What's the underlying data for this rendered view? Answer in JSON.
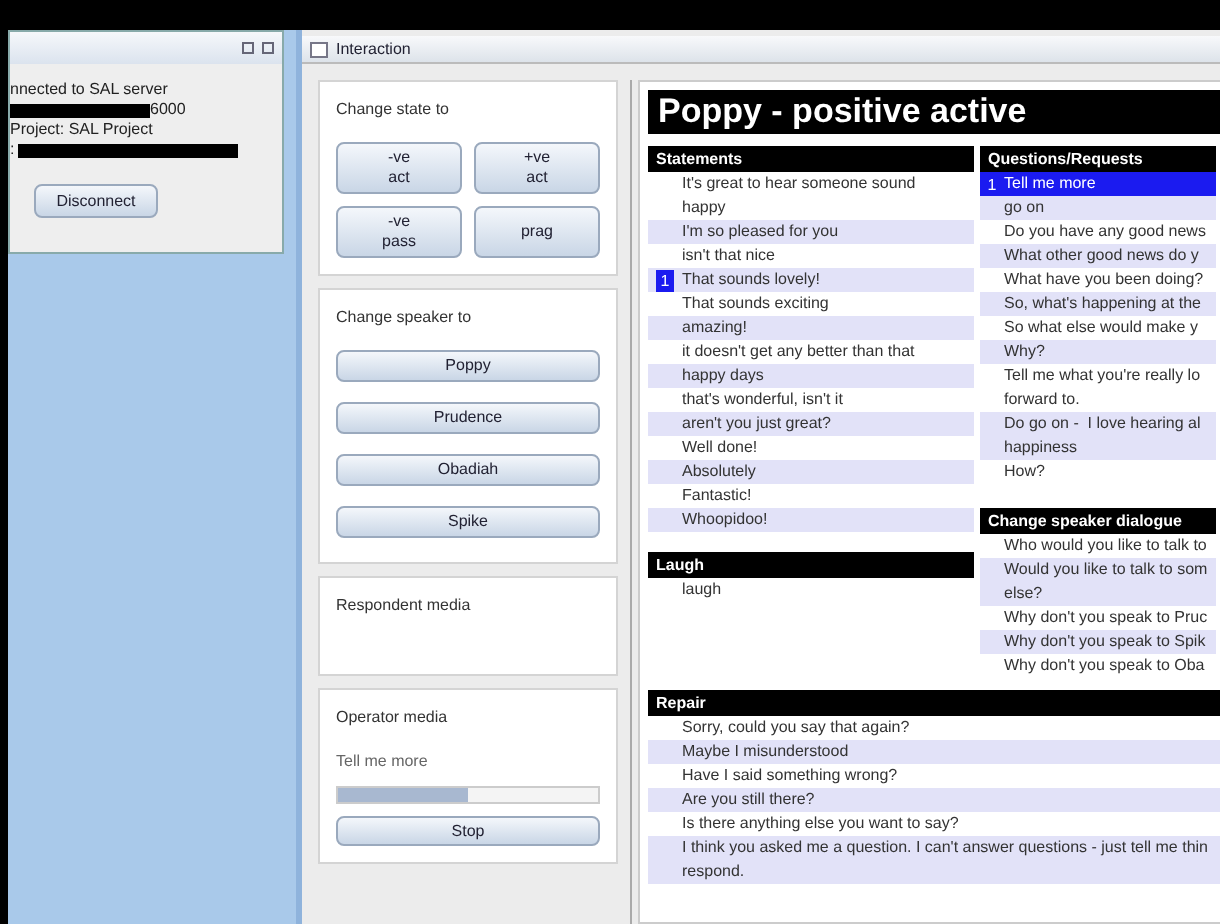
{
  "server_window": {
    "lines": [
      {
        "kind": "text",
        "text": "nnected to SAL server"
      },
      {
        "kind": "redacted_suffix",
        "text": "6000"
      },
      {
        "kind": "text",
        "text": "Project: SAL Project"
      },
      {
        "kind": "redacted_prefix",
        "text": ":"
      }
    ],
    "button": "Disconnect"
  },
  "window": {
    "title": "Interaction"
  },
  "state_panel": {
    "title": "Change state to",
    "buttons": [
      [
        "-ve",
        "act"
      ],
      [
        "+ve",
        "act"
      ],
      [
        "-ve",
        "pass"
      ],
      [
        "prag"
      ]
    ]
  },
  "speaker_panel": {
    "title": "Change speaker to",
    "buttons": [
      "Poppy",
      "Prudence",
      "Obadiah",
      "Spike"
    ]
  },
  "respondent_panel": {
    "title": "Respondent media"
  },
  "operator_panel": {
    "title": "Operator media",
    "caption": "Tell me more",
    "level": 0.5,
    "button": "Stop"
  },
  "heading": "Poppy - positive active",
  "statements": {
    "title": "Statements",
    "items": [
      {
        "text": "It's great to hear someone sound\nhappy"
      },
      {
        "text": "I'm so pleased for you"
      },
      {
        "text": "isn't that nice"
      },
      {
        "text": "That sounds lovely!",
        "marker": "1"
      },
      {
        "text": "That sounds exciting"
      },
      {
        "text": "amazing!"
      },
      {
        "text": "it doesn't get any better than that"
      },
      {
        "text": "happy days"
      },
      {
        "text": "that's wonderful, isn't it"
      },
      {
        "text": "aren't you just great?"
      },
      {
        "text": "Well done!"
      },
      {
        "text": "Absolutely"
      },
      {
        "text": "Fantastic!"
      },
      {
        "text": "Whoopidoo!"
      }
    ]
  },
  "questions": {
    "title": "Questions/Requests",
    "items": [
      {
        "text": "Tell me more",
        "selected": true,
        "marker": "1"
      },
      {
        "text": "go on",
        "selected": false
      },
      {
        "text": "Do you have any good news",
        "selected": false
      },
      {
        "text": "What other good news do y",
        "selected": false
      },
      {
        "text": "What have you been doing?",
        "selected": false
      },
      {
        "text": "So, what's happening at the",
        "selected": false
      },
      {
        "text": "So what else would make y",
        "selected": false
      },
      {
        "text": "Why?",
        "selected": false
      },
      {
        "text": "Tell me what you're really lo\nforward to.",
        "selected": false
      },
      {
        "text": "Do go on -  I love hearing al\nhappiness",
        "selected": false
      },
      {
        "text": "How?",
        "selected": false
      }
    ]
  },
  "laugh": {
    "title": "Laugh",
    "items": [
      {
        "text": "laugh"
      }
    ]
  },
  "speaker_dialogue": {
    "title": "Change speaker dialogue",
    "items": [
      {
        "text": "Who would you like to talk to"
      },
      {
        "text": "Would you like to talk to som\nelse?"
      },
      {
        "text": "Why don't you speak to Pruc"
      },
      {
        "text": "Why don't you speak to Spik"
      },
      {
        "text": "Why don't you speak to Oba"
      }
    ]
  },
  "repair": {
    "title": "Repair",
    "items": [
      {
        "text": "Sorry, could you say that again?"
      },
      {
        "text": "Maybe I misunderstood"
      },
      {
        "text": "Have I said something wrong?"
      },
      {
        "text": "Are you still there?"
      },
      {
        "text": "Is there anything else you want to say?"
      },
      {
        "text": "I think you asked me a question. I can't answer questions - just tell me thin\nrespond."
      }
    ]
  }
}
